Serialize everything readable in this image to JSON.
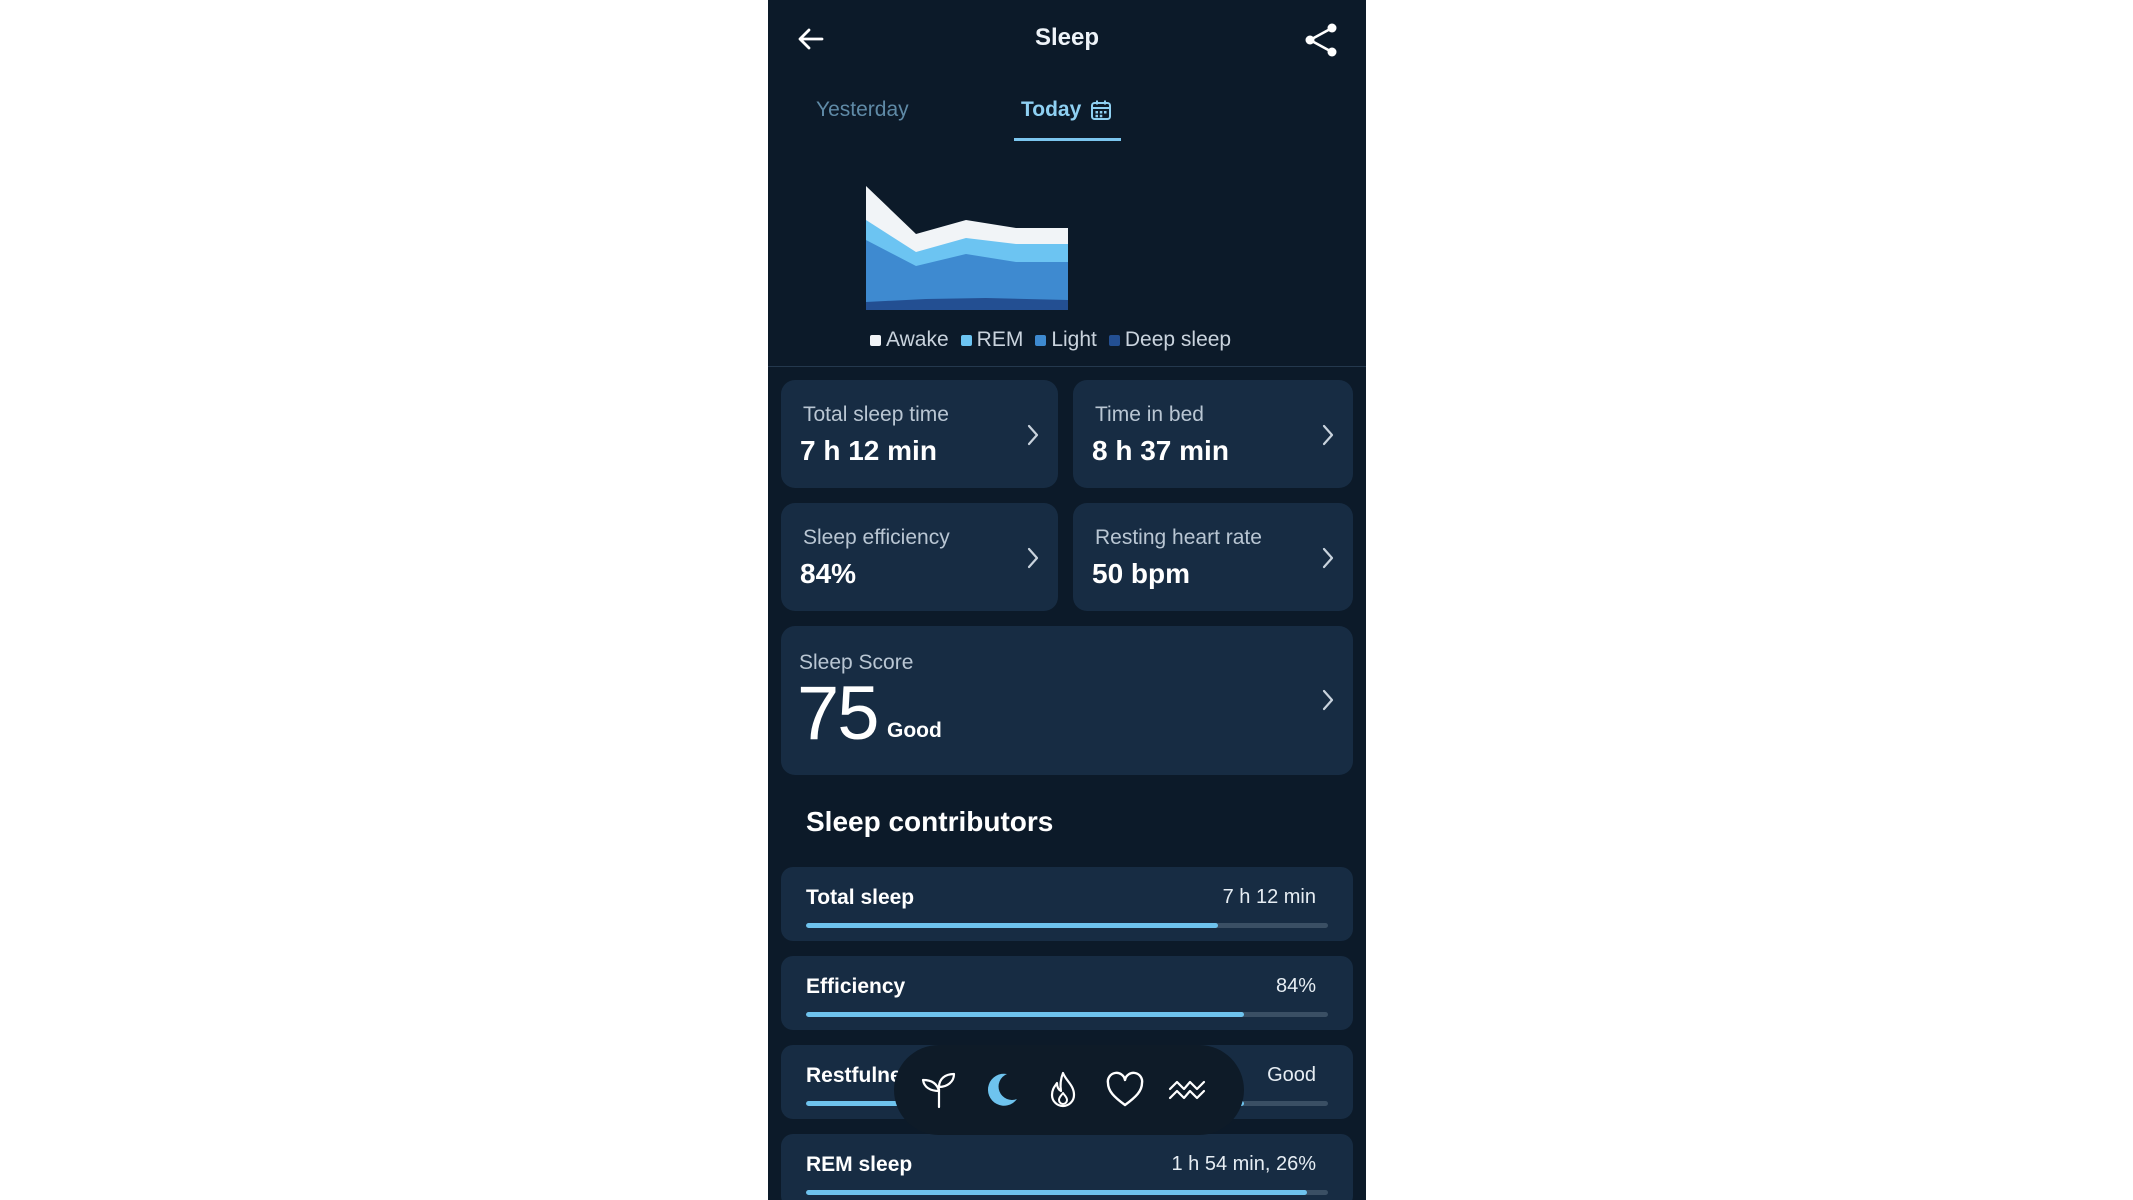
{
  "header": {
    "title": "Sleep"
  },
  "tabs": {
    "yesterday": "Yesterday",
    "today": "Today"
  },
  "chart_data": {
    "type": "area",
    "series": [
      {
        "name": "Awake",
        "color": "#f1f4f7"
      },
      {
        "name": "REM",
        "color": "#6cc4f2"
      },
      {
        "name": "Light",
        "color": "#3e8ad0"
      },
      {
        "name": "Deep sleep",
        "color": "#234f92"
      }
    ]
  },
  "legend": {
    "awake": "Awake",
    "rem": "REM",
    "light": "Light",
    "deep": "Deep sleep"
  },
  "cards": {
    "total_sleep": {
      "label": "Total sleep time",
      "value": "7 h 12 min"
    },
    "time_in_bed": {
      "label": "Time in bed",
      "value": "8 h 37 min"
    },
    "efficiency": {
      "label": "Sleep efficiency",
      "value": "84%"
    },
    "resting_hr": {
      "label": "Resting heart rate",
      "value": "50 bpm"
    }
  },
  "score": {
    "label": "Sleep Score",
    "value": "75",
    "grade": "Good"
  },
  "contributors_title": "Sleep contributors",
  "contributors": [
    {
      "name": "Total sleep",
      "value": "7 h 12 min",
      "fill": 0.79
    },
    {
      "name": "Efficiency",
      "value": "84%",
      "fill": 0.84
    },
    {
      "name": "Restfulness",
      "value": "Good",
      "fill": 0.84
    },
    {
      "name": "REM sleep",
      "value": "1 h 54 min, 26%",
      "fill": 0.96
    }
  ],
  "bottom_nav": [
    "sprout-icon",
    "moon-icon",
    "flame-icon",
    "heart-icon",
    "waves-icon"
  ]
}
